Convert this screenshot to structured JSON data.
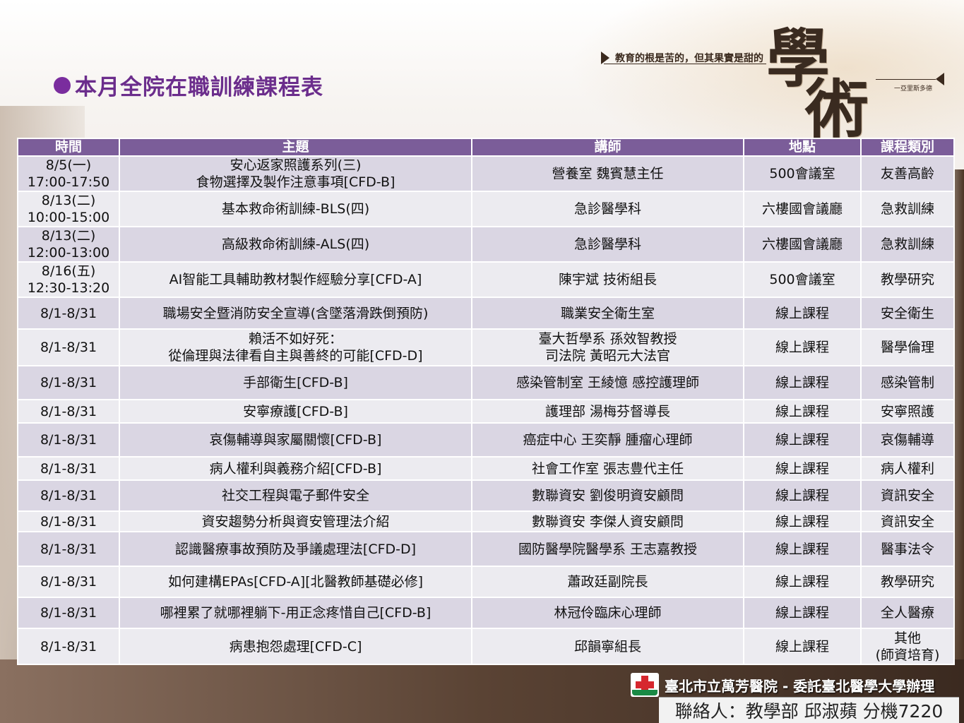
{
  "heading": "本月全院在職訓練課程表",
  "motto": "教育的根是苦的，但其果實是甜的",
  "motto_title": [
    "學",
    "術"
  ],
  "motto_attribution": "一亞里斯多德",
  "table": {
    "headers": [
      "時間",
      "主題",
      "講師",
      "地點",
      "課程類別"
    ],
    "rows": [
      {
        "time": "8/5(一)\n17:00-17:50",
        "topic": "安心返家照護系列(三)\n食物選擇及製作注意事項[CFD-B]",
        "speaker": "營養室 魏賓慧主任",
        "location": "500會議室",
        "category": "友善高齡"
      },
      {
        "time": "8/13(二)\n10:00-15:00",
        "topic": "基本救命術訓練-BLS(四)",
        "speaker": "急診醫學科",
        "location": "六樓國會議廳",
        "category": "急救訓練"
      },
      {
        "time": "8/13(二)\n12:00-13:00",
        "topic": "高級救命術訓練-ALS(四)",
        "speaker": "急診醫學科",
        "location": "六樓國會議廳",
        "category": "急救訓練"
      },
      {
        "time": "8/16(五)\n12:30-13:20",
        "topic": "AI智能工具輔助教材製作經驗分享[CFD-A]",
        "speaker": "陳宇斌 技術組長",
        "location": "500會議室",
        "category": "教學研究"
      },
      {
        "time": "8/1-8/31",
        "topic": "職場安全暨消防安全宣導(含墜落滑跌倒預防)",
        "speaker": "職業安全衛生室",
        "location": "線上課程",
        "category": "安全衛生"
      },
      {
        "time": "8/1-8/31",
        "topic": "賴活不如好死：\n從倫理與法律看自主與善終的可能[CFD-D]",
        "speaker": "臺大哲學系 孫效智教授\n司法院 黃昭元大法官",
        "location": "線上課程",
        "category": "醫學倫理"
      },
      {
        "time": "8/1-8/31",
        "topic": "手部衛生[CFD-B]",
        "speaker": "感染管制室 王綾憶 感控護理師",
        "location": "線上課程",
        "category": "感染管制"
      },
      {
        "time": "8/1-8/31",
        "topic": "安寧療護[CFD-B]",
        "speaker": "護理部 湯梅芬督導長",
        "location": "線上課程",
        "category": "安寧照護"
      },
      {
        "time": "8/1-8/31",
        "topic": "哀傷輔導與家屬關懷[CFD-B]",
        "speaker": "癌症中心 王奕靜 腫瘤心理師",
        "location": "線上課程",
        "category": "哀傷輔導"
      },
      {
        "time": "8/1-8/31",
        "topic": "病人權利與義務介紹[CFD-B]",
        "speaker": "社會工作室 張志豊代主任",
        "location": "線上課程",
        "category": "病人權利"
      },
      {
        "time": "8/1-8/31",
        "topic": "社交工程與電子郵件安全",
        "speaker": "數聯資安 劉俊明資安顧問",
        "location": "線上課程",
        "category": "資訊安全"
      },
      {
        "time": "8/1-8/31",
        "topic": "資安趨勢分析與資安管理法介紹",
        "speaker": "數聯資安 李傑人資安顧問",
        "location": "線上課程",
        "category": "資訊安全"
      },
      {
        "time": "8/1-8/31",
        "topic": "認識醫療事故預防及爭議處理法[CFD-D]",
        "speaker": "國防醫學院醫學系 王志嘉教授",
        "location": "線上課程",
        "category": "醫事法令"
      },
      {
        "time": "8/1-8/31",
        "topic": "如何建構EPAs[CFD-A][北醫教師基礎必修]",
        "speaker": "蕭政廷副院長",
        "location": "線上課程",
        "category": "教學研究"
      },
      {
        "time": "8/1-8/31",
        "topic": "哪裡累了就哪裡躺下-用正念疼惜自己[CFD-B]",
        "speaker": "林冠伶臨床心理師",
        "location": "線上課程",
        "category": "全人醫療"
      },
      {
        "time": "8/1-8/31",
        "topic": "病患抱怨處理[CFD-C]",
        "speaker": "邱韻寧組長",
        "location": "線上課程",
        "category": "其他\n(師資培育)"
      }
    ]
  },
  "footer": {
    "organization": "臺北市立萬芳醫院 - 委託臺北醫學大學辦理",
    "contact": "聯絡人：教學部 邱淑蘋 分機7220"
  },
  "colors": {
    "heading": "#6b2d8c",
    "header_bg": "#7b5d99",
    "row_odd": "#dad6e3",
    "row_even": "#ecebf0"
  }
}
